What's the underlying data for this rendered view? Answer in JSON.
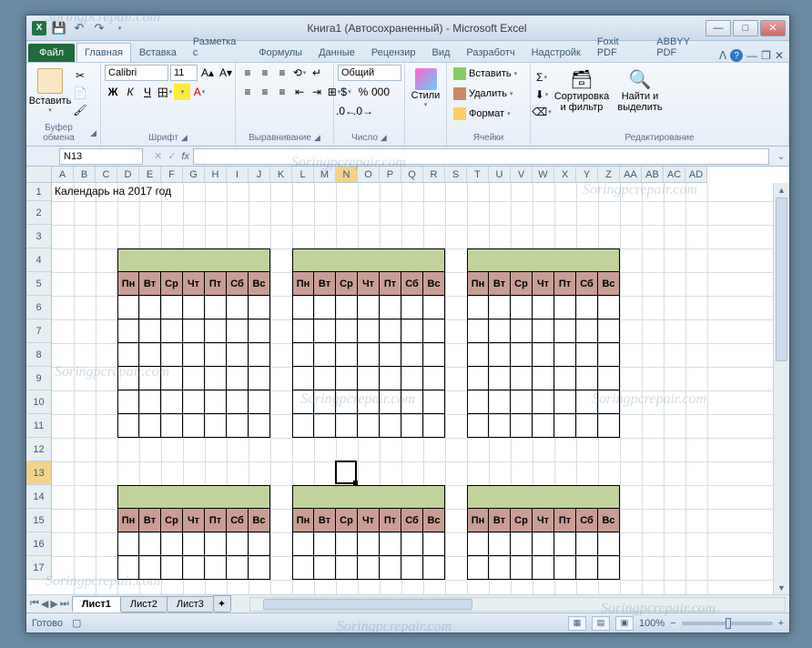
{
  "title": "Книга1 (Автосохраненный) - Microsoft Excel",
  "tabs": {
    "file": "Файл",
    "items": [
      "Главная",
      "Вставка",
      "Разметка с",
      "Формулы",
      "Данные",
      "Рецензир",
      "Вид",
      "Разработч",
      "Надстройк",
      "Foxit PDF",
      "ABBYY PDF"
    ],
    "active": 0
  },
  "ribbon": {
    "clipboard": {
      "label": "Буфер обмена",
      "paste": "Вставить"
    },
    "font": {
      "label": "Шрифт",
      "name": "Calibri",
      "size": "11"
    },
    "alignment": {
      "label": "Выравнивание"
    },
    "number": {
      "label": "Число",
      "format": "Общий"
    },
    "styles": {
      "label": "Стили",
      "btn": "Стили"
    },
    "cells": {
      "label": "Ячейки",
      "insert": "Вставить",
      "delete": "Удалить",
      "format": "Формат"
    },
    "editing": {
      "label": "Редактирование",
      "sort": "Сортировка и фильтр",
      "find": "Найти и выделить"
    }
  },
  "namebox": "N13",
  "fx": "fx",
  "columns": [
    "A",
    "B",
    "C",
    "D",
    "E",
    "F",
    "G",
    "H",
    "I",
    "J",
    "K",
    "L",
    "M",
    "N",
    "O",
    "P",
    "Q",
    "R",
    "S",
    "T",
    "U",
    "V",
    "W",
    "X",
    "Y",
    "Z",
    "AA",
    "AB",
    "AC",
    "AD"
  ],
  "selected_col": "N",
  "rows": [
    1,
    2,
    3,
    4,
    5,
    6,
    7,
    8,
    9,
    10,
    11,
    12,
    13,
    14,
    15,
    16,
    17
  ],
  "selected_row": 13,
  "cell_a1": "Календарь на 2017 год",
  "days": [
    "Пн",
    "Вт",
    "Ср",
    "Чт",
    "Пт",
    "Сб",
    "Вс"
  ],
  "sheets": {
    "items": [
      "Лист1",
      "Лист2",
      "Лист3"
    ],
    "active": 0
  },
  "status": "Готово",
  "zoom": "100%",
  "watermark": "Soringpcrepair.com"
}
